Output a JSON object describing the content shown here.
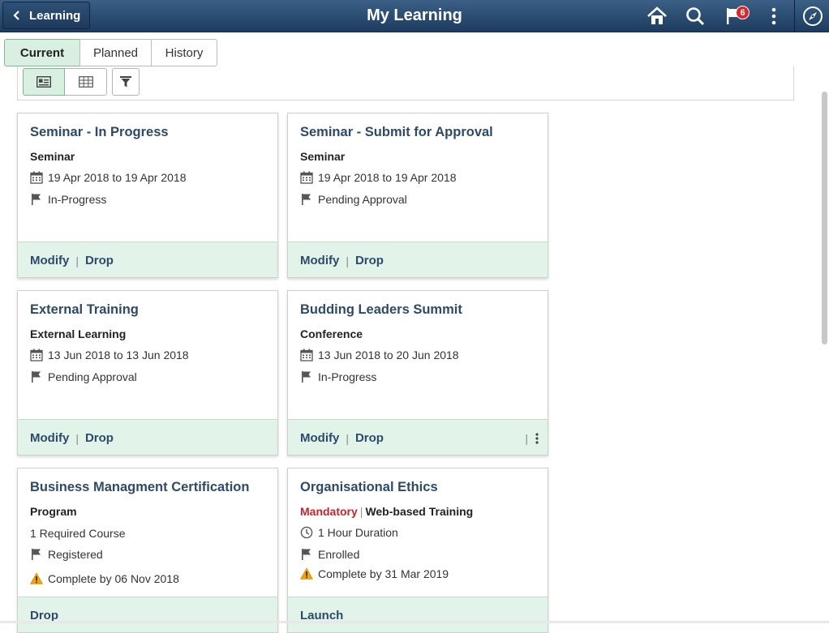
{
  "header": {
    "back_label": "Learning",
    "title": "My Learning",
    "notification_count": "6"
  },
  "tabs": [
    {
      "label": "Current",
      "active": true
    },
    {
      "label": "Planned",
      "active": false
    },
    {
      "label": "History",
      "active": false
    }
  ],
  "toolbar": {
    "views": [
      "card-view-icon",
      "grid-view-icon"
    ],
    "active_view": "card-view-icon",
    "filter_icon": "filter-icon"
  },
  "cards": [
    {
      "title": "Seminar - In Progress",
      "type": "Seminar",
      "date": "19 Apr 2018 to 19 Apr 2018",
      "status": "In-Progress",
      "actions": [
        "Modify",
        "Drop"
      ]
    },
    {
      "title": "Seminar - Submit for Approval",
      "type": "Seminar",
      "date": "19 Apr 2018 to 19 Apr 2018",
      "status": "Pending Approval",
      "actions": [
        "Modify",
        "Drop"
      ]
    },
    {
      "title": "External Training",
      "type": "External Learning",
      "date": "13 Jun 2018 to 13 Jun 2018",
      "status": "Pending Approval",
      "actions": [
        "Modify",
        "Drop"
      ]
    },
    {
      "title": "Budding Leaders Summit",
      "type": "Conference",
      "date": "13 Jun 2018 to 20 Jun 2018",
      "status": "In-Progress",
      "actions": [
        "Modify",
        "Drop"
      ]
    },
    {
      "title": "Business Managment Certification",
      "type": "Program",
      "info": "1 Required Course",
      "status": "Registered",
      "due": "Complete by 06 Nov 2018",
      "actions": [
        "Drop"
      ]
    },
    {
      "title": "Organisational Ethics",
      "mandatory": "Mandatory",
      "type": "Web-based Training",
      "duration": "1 Hour Duration",
      "status": "Enrolled",
      "due": "Complete by 31 Mar 2019",
      "actions": [
        "Launch"
      ]
    }
  ],
  "colors": {
    "header_top": "#3b5f86",
    "header_bottom": "#1d3c5f",
    "active_tab_bg": "#d8efe2",
    "card_footer_bg": "#e2f3ea",
    "title_color": "#2d4a68",
    "mandatory_color": "#c0262c",
    "warning_color": "#f0a30a"
  }
}
